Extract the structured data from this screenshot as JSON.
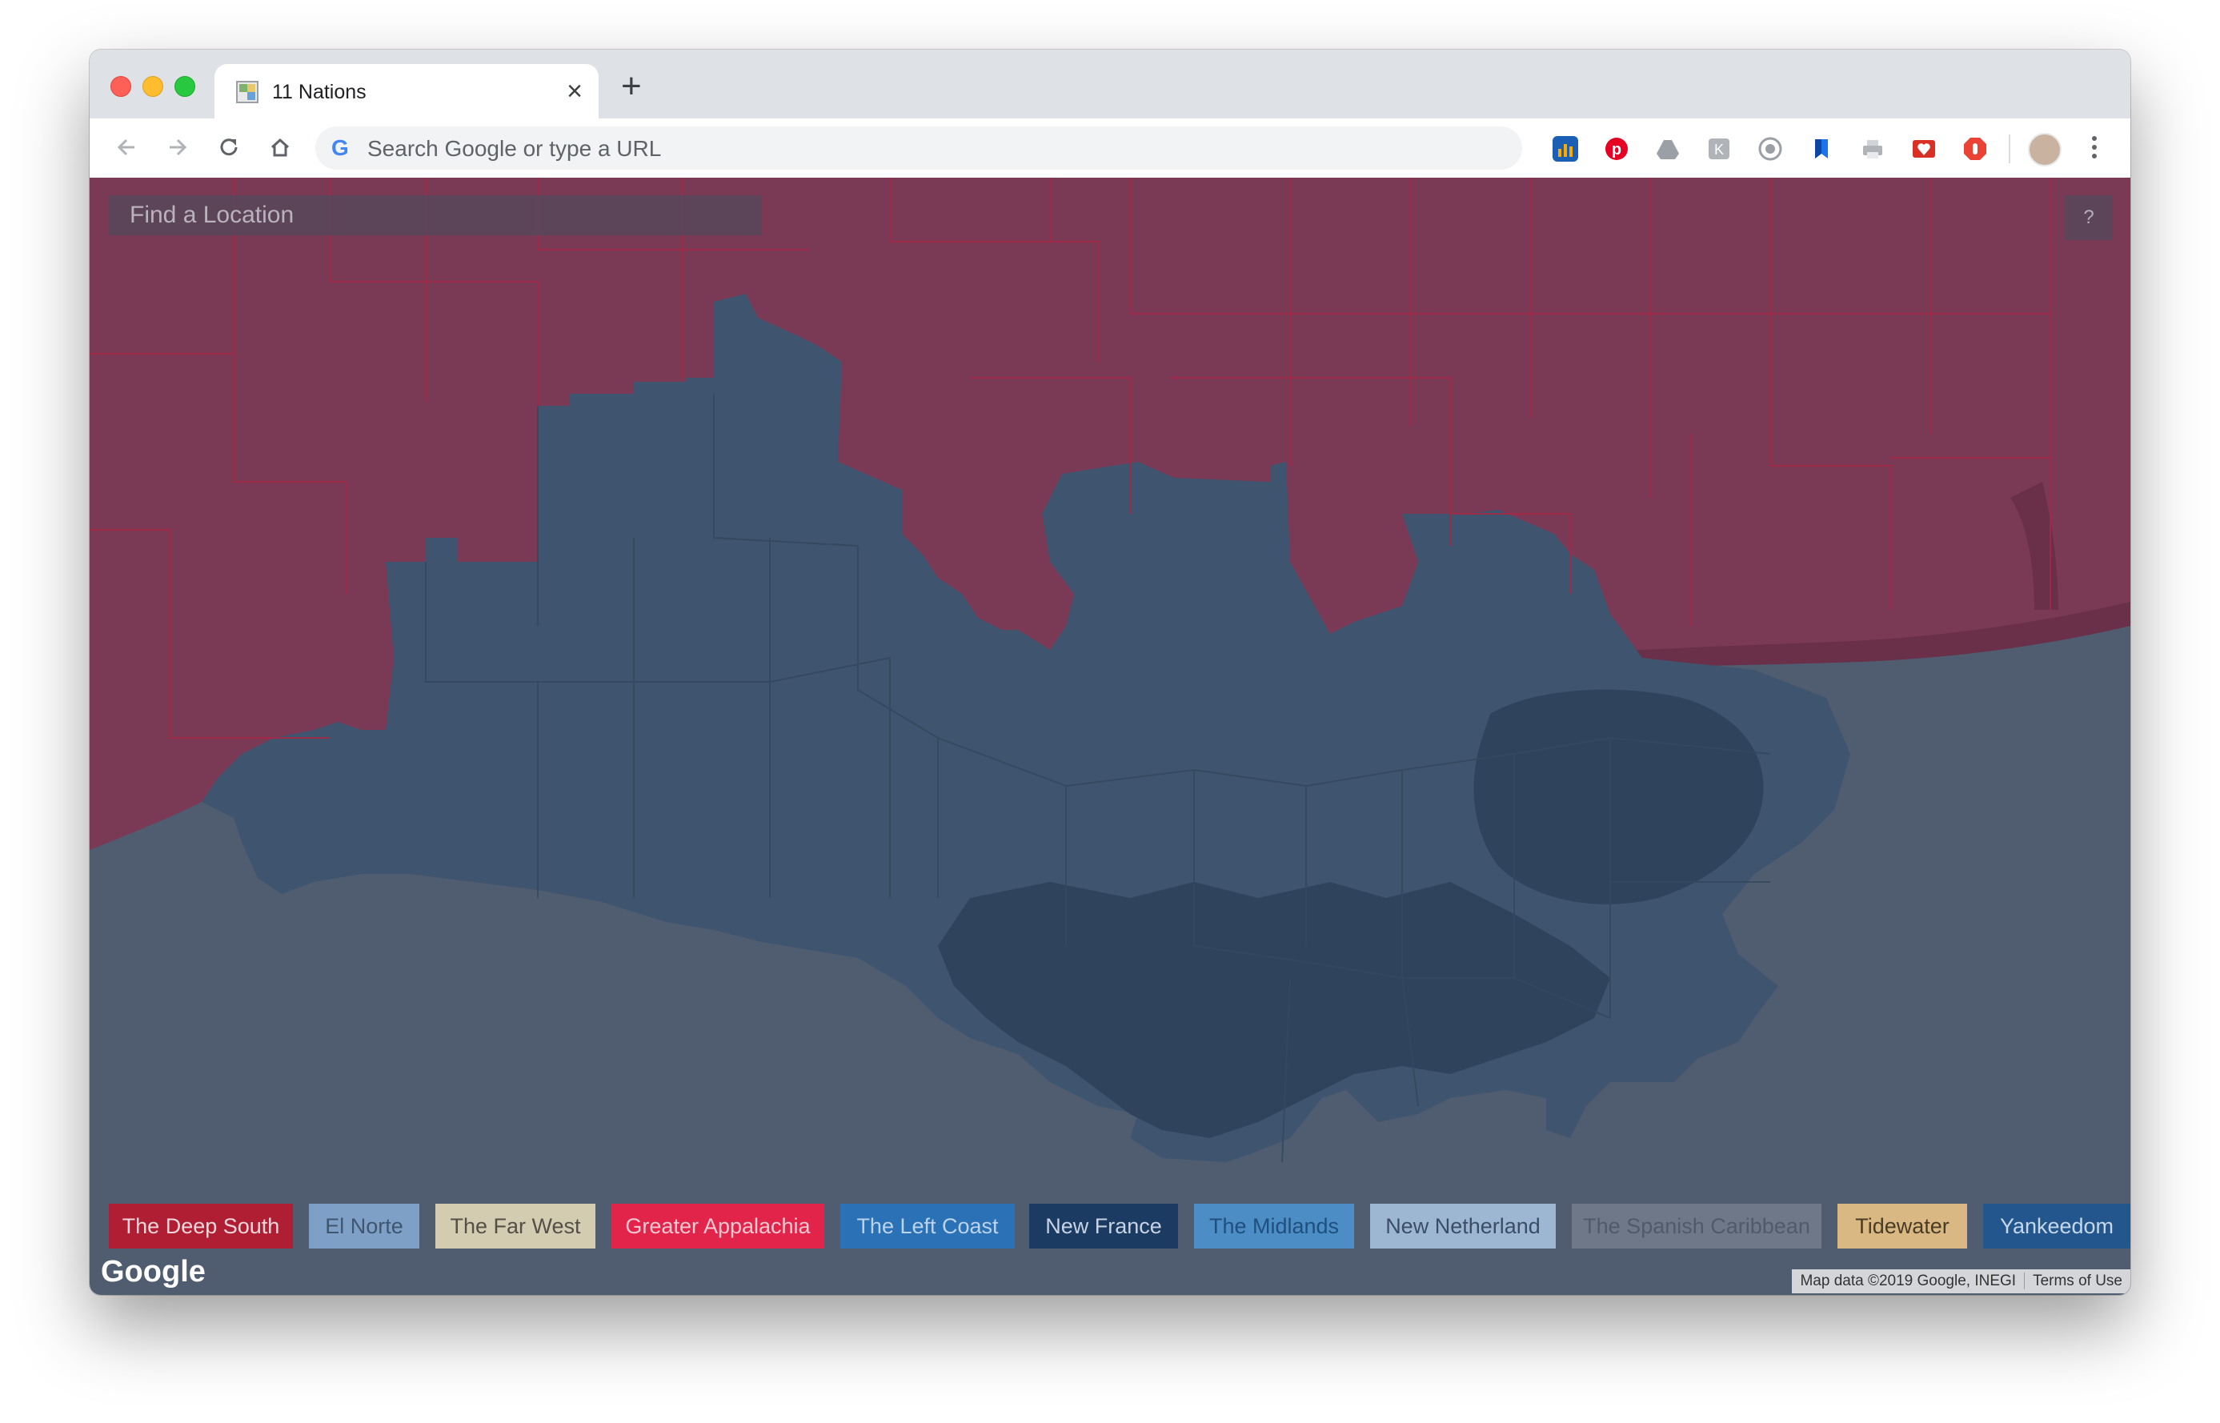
{
  "browser": {
    "tab_title": "11 Nations",
    "omnibox_placeholder": "Search Google or type a URL",
    "omnibox_g": "G",
    "new_tab": "+",
    "tab_close": "×"
  },
  "map": {
    "search_placeholder": "Find a Location",
    "help_label": "?",
    "google_logo": "Google",
    "attribution": "Map data ©2019 Google, INEGI",
    "terms": "Terms of Use",
    "colors": {
      "water": "#505c70",
      "deep_south_overlay": "#7a3a55",
      "new_france_overlay": "#3f546e"
    }
  },
  "legend": [
    {
      "label": "The Deep South",
      "bg": "#b01e33",
      "fg": "#f4d7dc"
    },
    {
      "label": "El Norte",
      "bg": "#7fa0c6",
      "fg": "#3f5570"
    },
    {
      "label": "The Far West",
      "bg": "#d4ccb1",
      "fg": "#545048"
    },
    {
      "label": "Greater Appalachia",
      "bg": "#e2234a",
      "fg": "#f6c8d2"
    },
    {
      "label": "The Left Coast",
      "bg": "#2a71b6",
      "fg": "#bcd3ec"
    },
    {
      "label": "New France",
      "bg": "#1c3b63",
      "fg": "#c7d3e4"
    },
    {
      "label": "The Midlands",
      "bg": "#4d8dc6",
      "fg": "#1f4f7c"
    },
    {
      "label": "New Netherland",
      "bg": "#9db7d3",
      "fg": "#3b4e66"
    },
    {
      "label": "The Spanish Caribbean",
      "bg": "#6f7889",
      "fg": "#515a6b"
    },
    {
      "label": "Tidewater",
      "bg": "#d9b883",
      "fg": "#4a3c24"
    },
    {
      "label": "Yankeedom",
      "bg": "#22568d",
      "fg": "#c6d7ea"
    }
  ],
  "extensions": [
    {
      "name": "analytics-extension-icon",
      "color": "#1a5fb4"
    },
    {
      "name": "pinterest-extension-icon",
      "color": "#e60023"
    },
    {
      "name": "drive-extension-icon",
      "color": "#9aa0a6"
    },
    {
      "name": "extension-k-icon",
      "color": "#b0b3b8"
    },
    {
      "name": "extension-circle-icon",
      "color": "#9aa0a6"
    },
    {
      "name": "bookmark-extension-icon",
      "color": "#1a73e8"
    },
    {
      "name": "print-extension-icon",
      "color": "#b0b3b8"
    },
    {
      "name": "heart-extension-icon",
      "color": "#d93025"
    },
    {
      "name": "stop-hand-extension-icon",
      "color": "#ea4335"
    }
  ]
}
